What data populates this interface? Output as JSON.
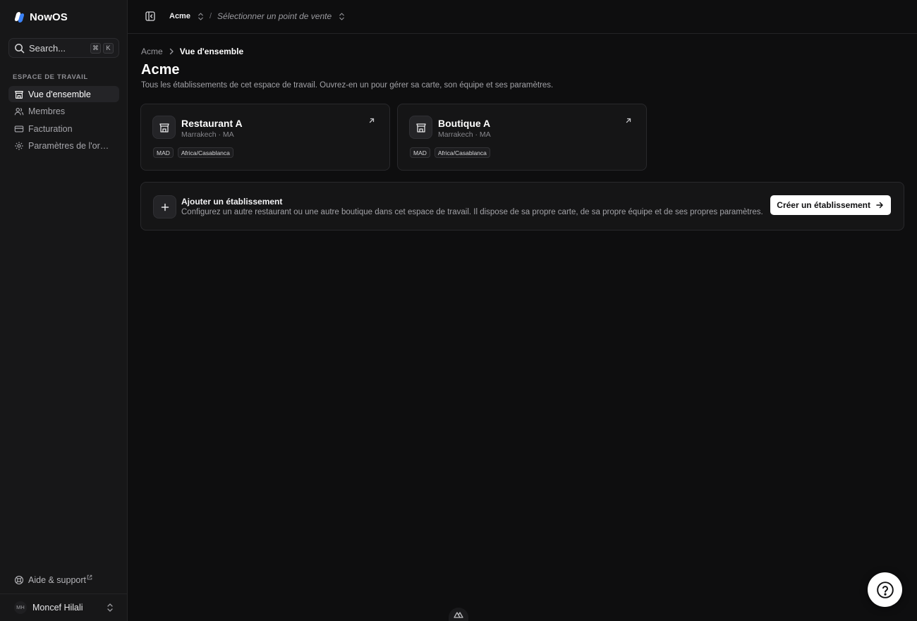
{
  "app": {
    "name": "NowOS"
  },
  "search": {
    "label": "Search...",
    "kbd": [
      "⌘",
      "K"
    ]
  },
  "sidebar": {
    "section_label": "ESPACE DE TRAVAIL",
    "items": [
      {
        "label": "Vue d'ensemble",
        "icon": "store-icon",
        "active": true
      },
      {
        "label": "Membres",
        "icon": "users-icon",
        "active": false
      },
      {
        "label": "Facturation",
        "icon": "credit-card-icon",
        "active": false
      },
      {
        "label": "Paramètres de l'organ...",
        "icon": "gear-icon",
        "active": false
      }
    ],
    "help_label": "Aide & support",
    "user": {
      "initials": "MH",
      "name": "Moncef Hilali"
    }
  },
  "topbar": {
    "org": "Acme",
    "separator": "/",
    "point_of_sale_placeholder": "Sélectionner un point de vente"
  },
  "breadcrumb": {
    "home": "Acme",
    "current": "Vue d'ensemble"
  },
  "page": {
    "title": "Acme",
    "description": "Tous les établissements de cet espace de travail. Ouvrez-en un pour gérer sa carte, son équipe et ses paramètres."
  },
  "establishments": [
    {
      "name": "Restaurant A",
      "location": "Marrakech · MA",
      "tags": [
        "MAD",
        "Africa/Casablanca"
      ]
    },
    {
      "name": "Boutique A",
      "location": "Marrakech · MA",
      "tags": [
        "MAD",
        "Africa/Casablanca"
      ]
    }
  ],
  "add_establishment": {
    "title": "Ajouter un établissement",
    "description": "Configurez un autre restaurant ou une autre boutique dans cet espace de travail. Il dispose de sa propre carte, de sa propre équipe et de ses propres paramètres.",
    "button_label": "Créer un établissement"
  },
  "colors": {
    "background": "#0e0e0f",
    "sidebar": "#171718",
    "accent": "#3b82f6",
    "card": "#151516"
  }
}
